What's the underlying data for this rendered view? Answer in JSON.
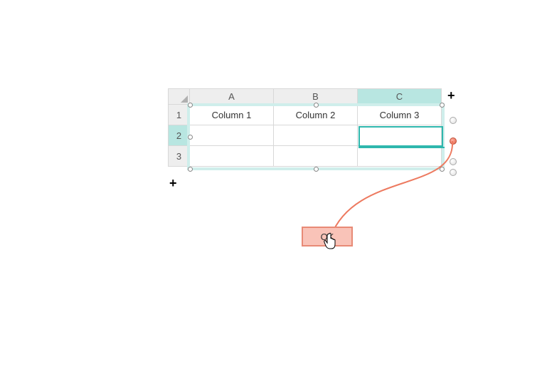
{
  "grid": {
    "columns": [
      "A",
      "B",
      "C"
    ],
    "rows": [
      "1",
      "2",
      "3"
    ],
    "headers": [
      "Column 1",
      "Column 2",
      "Column 3"
    ],
    "selected_column_index": 2,
    "selected_row_index": 1,
    "active_cell": "C2"
  },
  "button": {
    "ok_label": "OK"
  },
  "colors": {
    "teal": "#2fb7ad",
    "teal_light": "#cfeeeb",
    "salmon_fill": "#f9c3b8",
    "salmon_border": "#e88a76"
  }
}
